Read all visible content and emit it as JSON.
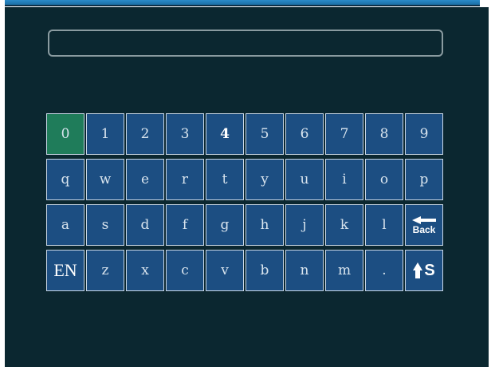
{
  "input": {
    "value": ""
  },
  "colors": {
    "background": "#0b2730",
    "key": "#1c4e82",
    "key_selected": "#1f7c5a",
    "key_border": "#c9d7e6",
    "top_bar": "#1b6fa5"
  },
  "keyboard": {
    "selected_key": "0",
    "rows": [
      [
        "0",
        "1",
        "2",
        "3",
        "4",
        "5",
        "6",
        "7",
        "8",
        "9"
      ],
      [
        "q",
        "w",
        "e",
        "r",
        "t",
        "y",
        "u",
        "i",
        "o",
        "p"
      ],
      [
        "a",
        "s",
        "d",
        "f",
        "g",
        "h",
        "j",
        "k",
        "l",
        "Back"
      ],
      [
        "EN",
        "z",
        "x",
        "c",
        "v",
        "b",
        "n",
        "m",
        ".",
        "S"
      ]
    ],
    "icons": {
      "back": "back-arrow-icon",
      "shift": "shift-up-arrow-icon"
    }
  }
}
